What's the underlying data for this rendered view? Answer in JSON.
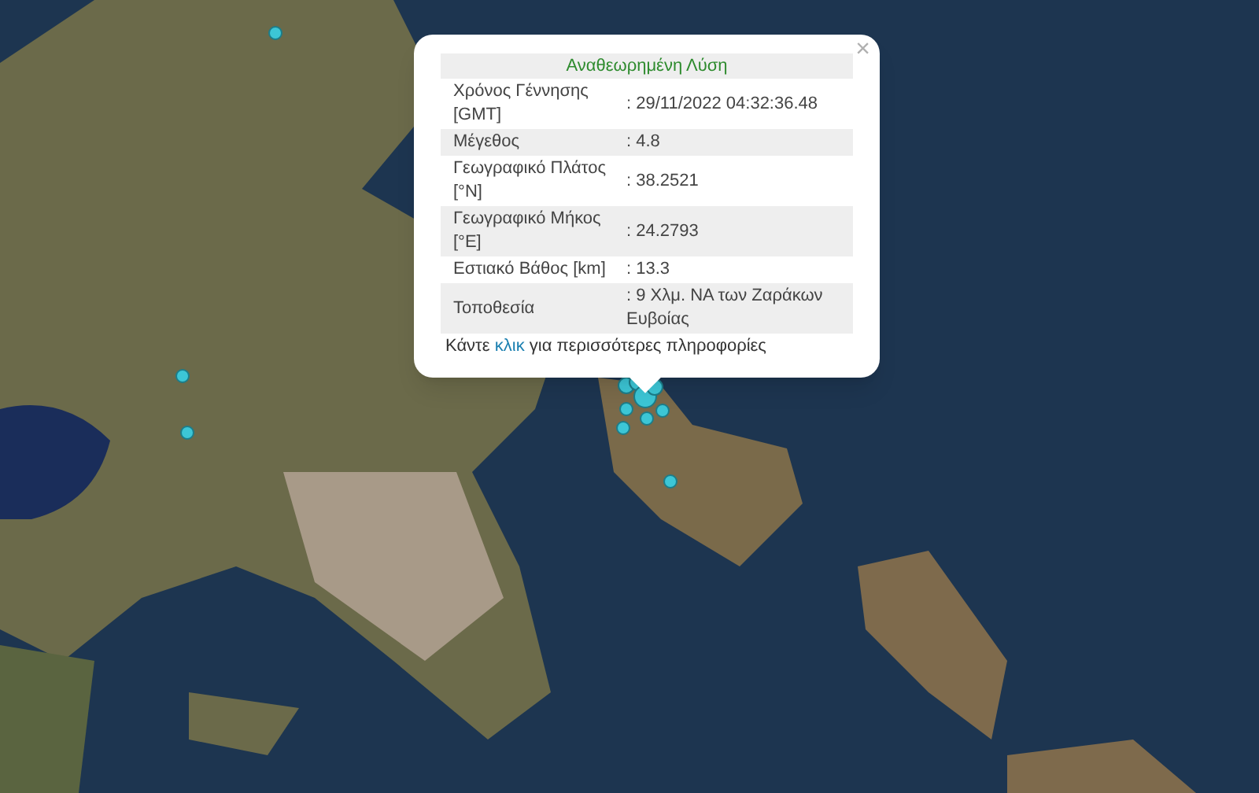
{
  "popup": {
    "close": "×",
    "title": "Αναθεωρημένη Λύση",
    "rows": [
      {
        "label": "Χρόνος Γέννησης [GMT]",
        "value": ": 29/11/2022 04:32:36.48"
      },
      {
        "label": "Μέγεθος",
        "value": ": 4.8"
      },
      {
        "label": "Γεωγραφικό Πλάτος [°N]",
        "value": ": 38.2521"
      },
      {
        "label": "Γεωγραφικό Μήκος [°E]",
        "value": ": 24.2793"
      },
      {
        "label": "Εστιακό Βάθος [km]",
        "value": ": 13.3"
      },
      {
        "label": "Τοποθεσία",
        "value": ": 9 Χλμ. ΝΑ των Ζαράκων Ευβοίας"
      }
    ],
    "footer": {
      "before": "Κάντε",
      "link": "κλικ",
      "after": "για περισσότερες πληροφορίες"
    }
  }
}
